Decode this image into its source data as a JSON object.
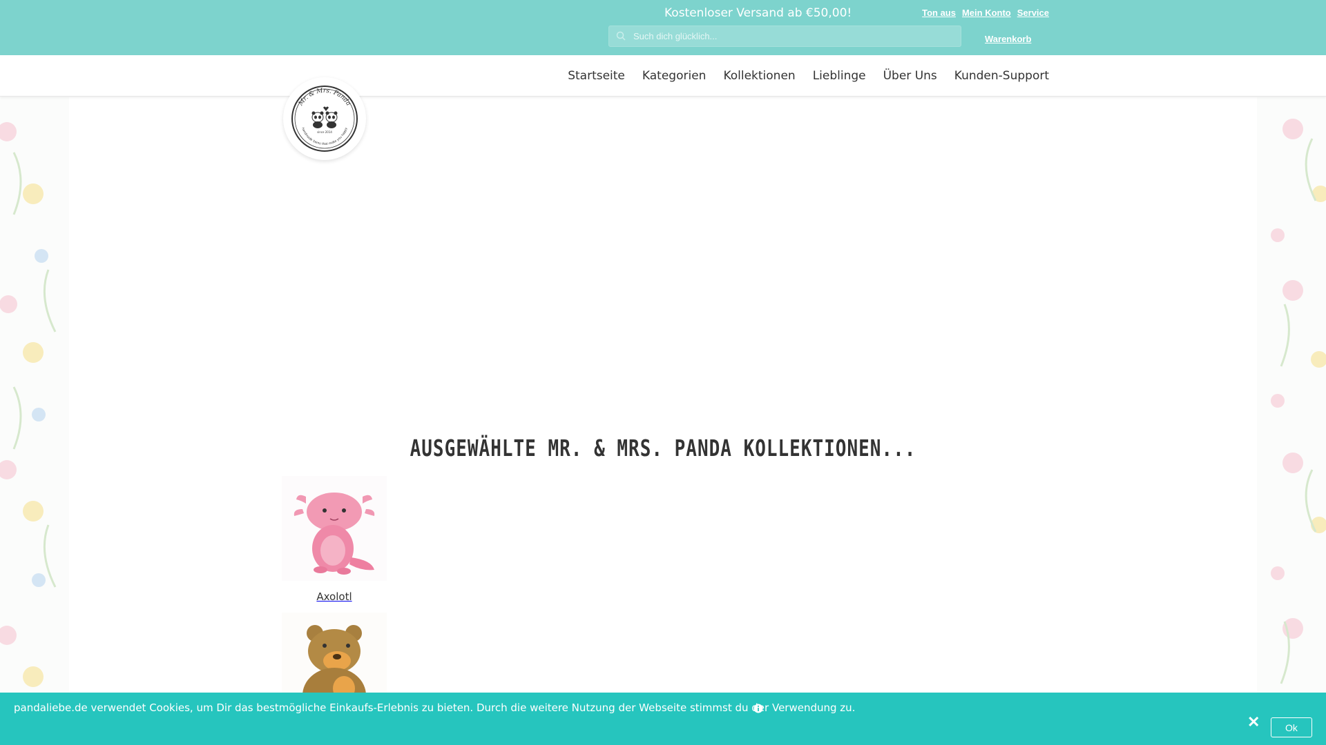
{
  "topbar": {
    "promo": "Kostenloser Versand ab €50,00!",
    "links": [
      "Ton aus",
      "Mein Konto",
      "Service"
    ],
    "search_placeholder": "Such dich glücklich...",
    "cart": "Warenkorb",
    "background": "#7dd3cd"
  },
  "nav": {
    "items": [
      "Startseite",
      "Kategorien",
      "Kollektionen",
      "Lieblinge",
      "Über Uns",
      "Kunden-Support"
    ]
  },
  "logo": {
    "text_top": "Mr. & Mrs. Panda",
    "text_since": "since 2014",
    "text_bottom": "handmade items that make you happy"
  },
  "main": {
    "section_title": "AUSGEWÄHLTE MR. & MRS. PANDA KOLLEKTIONEN...",
    "collections": [
      {
        "label": "Axolotl",
        "icon": "axolotl-illustration"
      },
      {
        "label": "",
        "icon": "bear-illustration"
      }
    ]
  },
  "cookie": {
    "text": "pandaliebe.de verwendet Cookies, um Dir das bestmögliche Einkaufs-Erlebnis zu bieten. Durch die weitere Nutzung der Webseite stimmst du der Verwendung zu.",
    "ok": "Ok",
    "close": "✕",
    "background": "#26c5be"
  }
}
